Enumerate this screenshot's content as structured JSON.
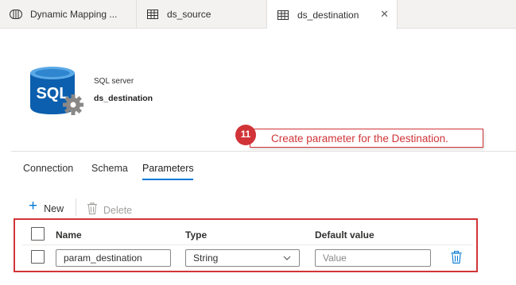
{
  "tabs": [
    {
      "label": "Dynamic Mapping ...",
      "icon": "dataflow-icon"
    },
    {
      "label": "ds_source",
      "icon": "table-icon"
    },
    {
      "label": "ds_destination",
      "icon": "table-icon",
      "active": true,
      "close": "✕"
    }
  ],
  "header": {
    "icon": "sql-server-icon",
    "icon_text": "SQL",
    "type_label": "SQL server",
    "dataset_name": "ds_destination"
  },
  "callout": {
    "number": "11",
    "text": "Create parameter for the Destination."
  },
  "subtabs": [
    "Connection",
    "Schema",
    "Parameters"
  ],
  "active_subtab": "Parameters",
  "toolbar": {
    "new_label": "New",
    "new_icon": "+",
    "delete_label": "Delete"
  },
  "table": {
    "columns": [
      "Name",
      "Type",
      "Default value"
    ],
    "rows": [
      {
        "name": "param_destination",
        "type": "String",
        "default_placeholder": "Value"
      }
    ]
  },
  "colors": {
    "accent": "#0078d4",
    "callout_red": "#d13438"
  }
}
